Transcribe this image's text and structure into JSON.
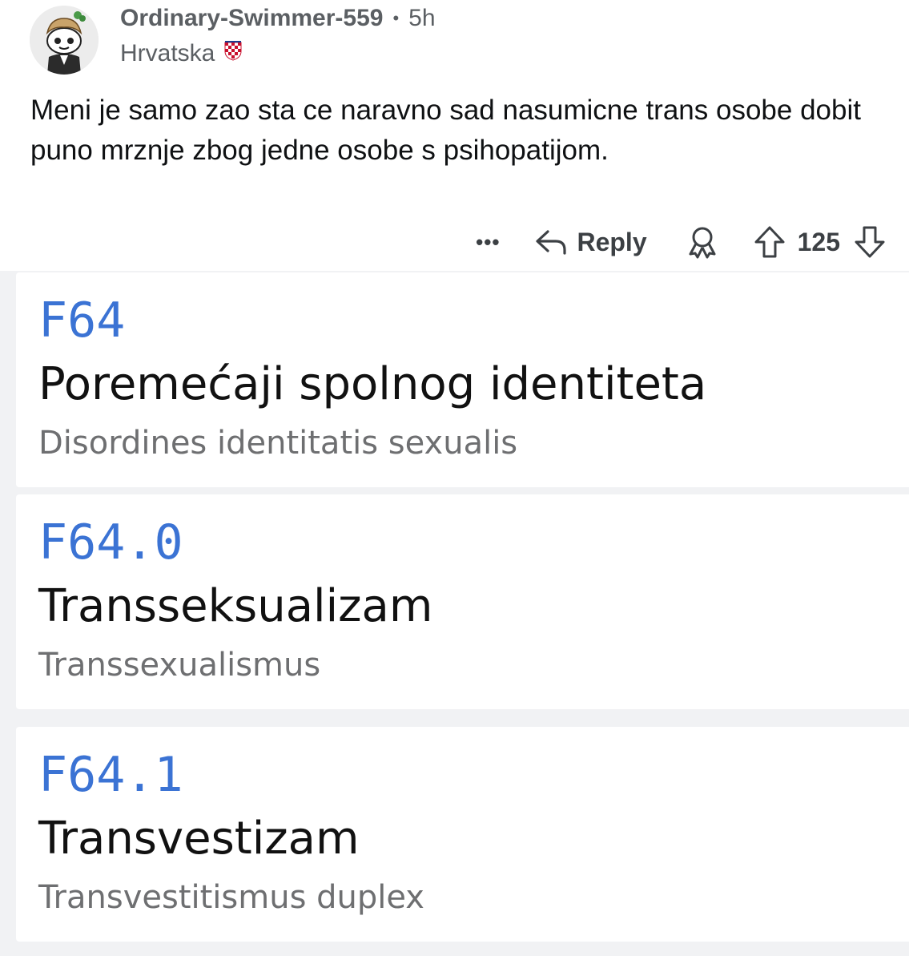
{
  "comment": {
    "username": "Ordinary-Swimmer-559",
    "separator": "•",
    "time": "5h",
    "flair": "Hrvatska",
    "flair_icon": "croatia-coat-of-arms-icon",
    "avatar_icon": "reddit-snoo-avatar-icon",
    "body": "Meni je samo zao sta ce naravno sad nasumicne trans osobe dobit puno mrznje zbog jedne osobe s psihopatijom.",
    "actions": {
      "more_label": "•••",
      "reply_label": "Reply",
      "score": "125"
    }
  },
  "diagnoses": [
    {
      "code": "F64",
      "title": "Poremećaji spolnog identiteta",
      "latin": "Disordines identitatis sexualis"
    },
    {
      "code": "F64.0",
      "title": "Transseksualizam",
      "latin": "Transsexualismus"
    },
    {
      "code": "F64.1",
      "title": "Transvestizam",
      "latin": "Transvestitismus duplex"
    }
  ],
  "colors": {
    "code_blue": "#3b73d4",
    "meta_gray": "#5b5f63",
    "latin_gray": "#6e6f71",
    "card_bg": "#ffffff",
    "gap_bg": "#f1f2f4"
  }
}
